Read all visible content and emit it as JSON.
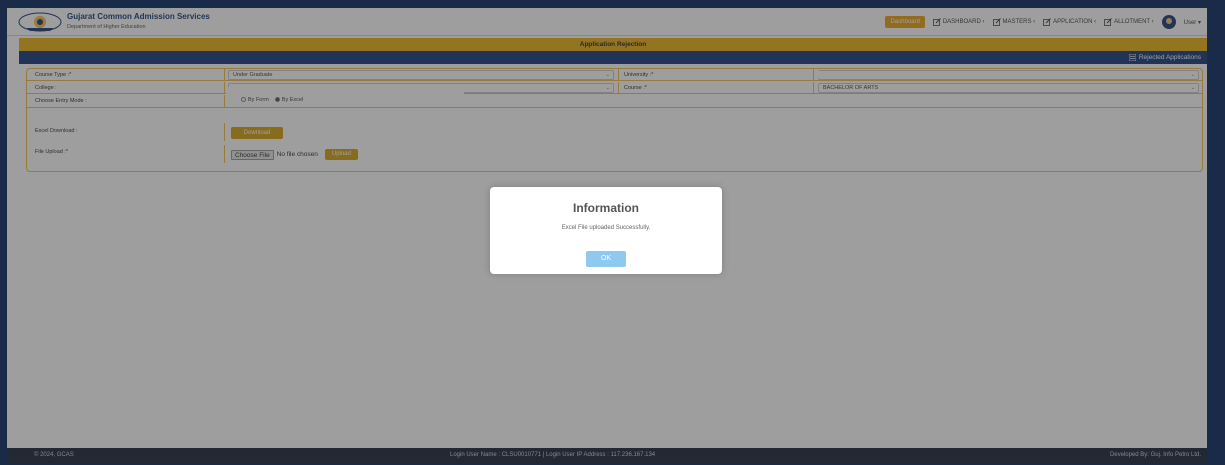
{
  "header": {
    "brand_title": "Gujarat Common Admission Services",
    "brand_subtitle": "Department of Higher Education",
    "nav": {
      "dashboard_button": "Dashboard",
      "items": [
        "DASHBOARD ‹",
        "MASTERS ‹",
        "APPLICATION ‹",
        "ALLOTMENT ‹"
      ],
      "user_label": "User ▾"
    }
  },
  "page": {
    "title": "Application Rejection",
    "rejected_link": "Rejected Applications"
  },
  "form": {
    "course_type_label": "Course Type :*",
    "course_type_value": "Under Graduate",
    "university_label": "University :*",
    "college_label": "College :",
    "course_label": "Course :*",
    "course_value": "BACHELOR OF ARTS",
    "entry_mode_label": "Choose Entry Mode :",
    "entry_mode_options": [
      "By Form",
      "By Excel"
    ],
    "entry_mode_selected": "By Excel",
    "excel_download_label": "Excel Download :",
    "download_button": "Download",
    "file_upload_label": "File Upload :*",
    "choose_file_button": "Choose File",
    "no_file_text": "No file chosen",
    "upload_button": "Upload"
  },
  "footer": {
    "copyright": "© 2024, GCAS",
    "login_info": "Login User Name : CLSU0010771 | Login User IP Address : 117.236.167.134",
    "developer": "Developed By: Guj. Info Petro Ltd."
  },
  "dialog": {
    "title": "Information",
    "message": "Excel File uploaded Successfully.",
    "ok_button": "OK"
  },
  "colors": {
    "accent_yellow": "#ecb21a",
    "nav_blue": "#1d3f7e",
    "footer_dark": "#1e2b3c",
    "ok_blue": "#8fc9f0"
  }
}
